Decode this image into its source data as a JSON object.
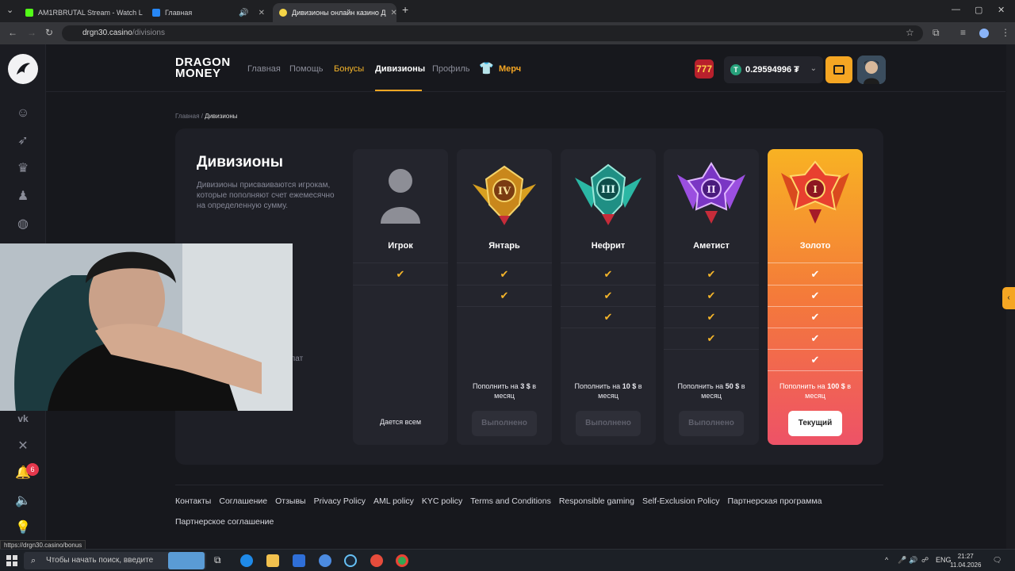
{
  "browser": {
    "tabs": [
      {
        "label": "AM1RBRUTAL Stream - Watch L"
      },
      {
        "label": "Главная"
      },
      {
        "label": "Дивизионы онлайн казино Д"
      }
    ],
    "new_tab": "+",
    "url_domain": "drgn30.casino",
    "url_path": "/divisions",
    "status_url": "https://drgn30.casino/bonus"
  },
  "site": {
    "brand_line1": "DRAGON",
    "brand_line2": "MONEY",
    "nav": {
      "home": "Главная",
      "help": "Помощь",
      "bonuses": "Бонусы",
      "divisions": "Дивизионы",
      "profile": "Профиль",
      "merch": "Мерч"
    },
    "slot_label": "777",
    "balance": "0.29594996 ₮",
    "notification_count": "6",
    "breadcrumb_home": "Главная",
    "breadcrumb_sep": "/",
    "breadcrumb_current": "Дивизионы",
    "page_title": "Дивизионы",
    "page_description": "Дивизионы присваиваются игрокам, которые пополняют счет ежемесячно на определенную сумму.",
    "page_partial_text": "плат",
    "divisions": [
      {
        "name": "Игрок",
        "checks": 1,
        "note": "Дается всем"
      },
      {
        "name": "Янтарь",
        "checks": 2,
        "req_pre": "Пополнить на ",
        "req_amount": "3 $",
        "req_post": " в месяц",
        "button": "Выполнено",
        "roman": "IV"
      },
      {
        "name": "Нефрит",
        "checks": 3,
        "req_pre": "Пополнить на ",
        "req_amount": "10 $",
        "req_post": " в месяц",
        "button": "Выполнено",
        "roman": "III"
      },
      {
        "name": "Аметист",
        "checks": 4,
        "req_pre": "Пополнить на ",
        "req_amount": "50 $",
        "req_post": " в месяц",
        "button": "Выполнено",
        "roman": "II"
      },
      {
        "name": "Золото",
        "checks": 5,
        "req_pre": "Пополнить на ",
        "req_amount": "100 $",
        "req_post": " в месяц",
        "button": "Текущий",
        "roman": "I"
      }
    ],
    "footer_links": [
      "Контакты",
      "Соглашение",
      "Отзывы",
      "Privacy Policy",
      "AML policy",
      "KYC policy",
      "Terms and Conditions",
      "Responsible gaming",
      "Self-Exclusion Policy",
      "Партнерская программа",
      "Партнерское соглашение"
    ]
  },
  "taskbar": {
    "search_placeholder": "Чтобы начать поиск, введите",
    "lang": "ENG",
    "time": "21:27",
    "date": "11.04.2026"
  },
  "colors": {
    "accent": "#f5a623",
    "amber": "#d8a020",
    "jade": "#2bb7a4",
    "amethyst": "#9b4fe0",
    "gold": "#e8402f"
  }
}
